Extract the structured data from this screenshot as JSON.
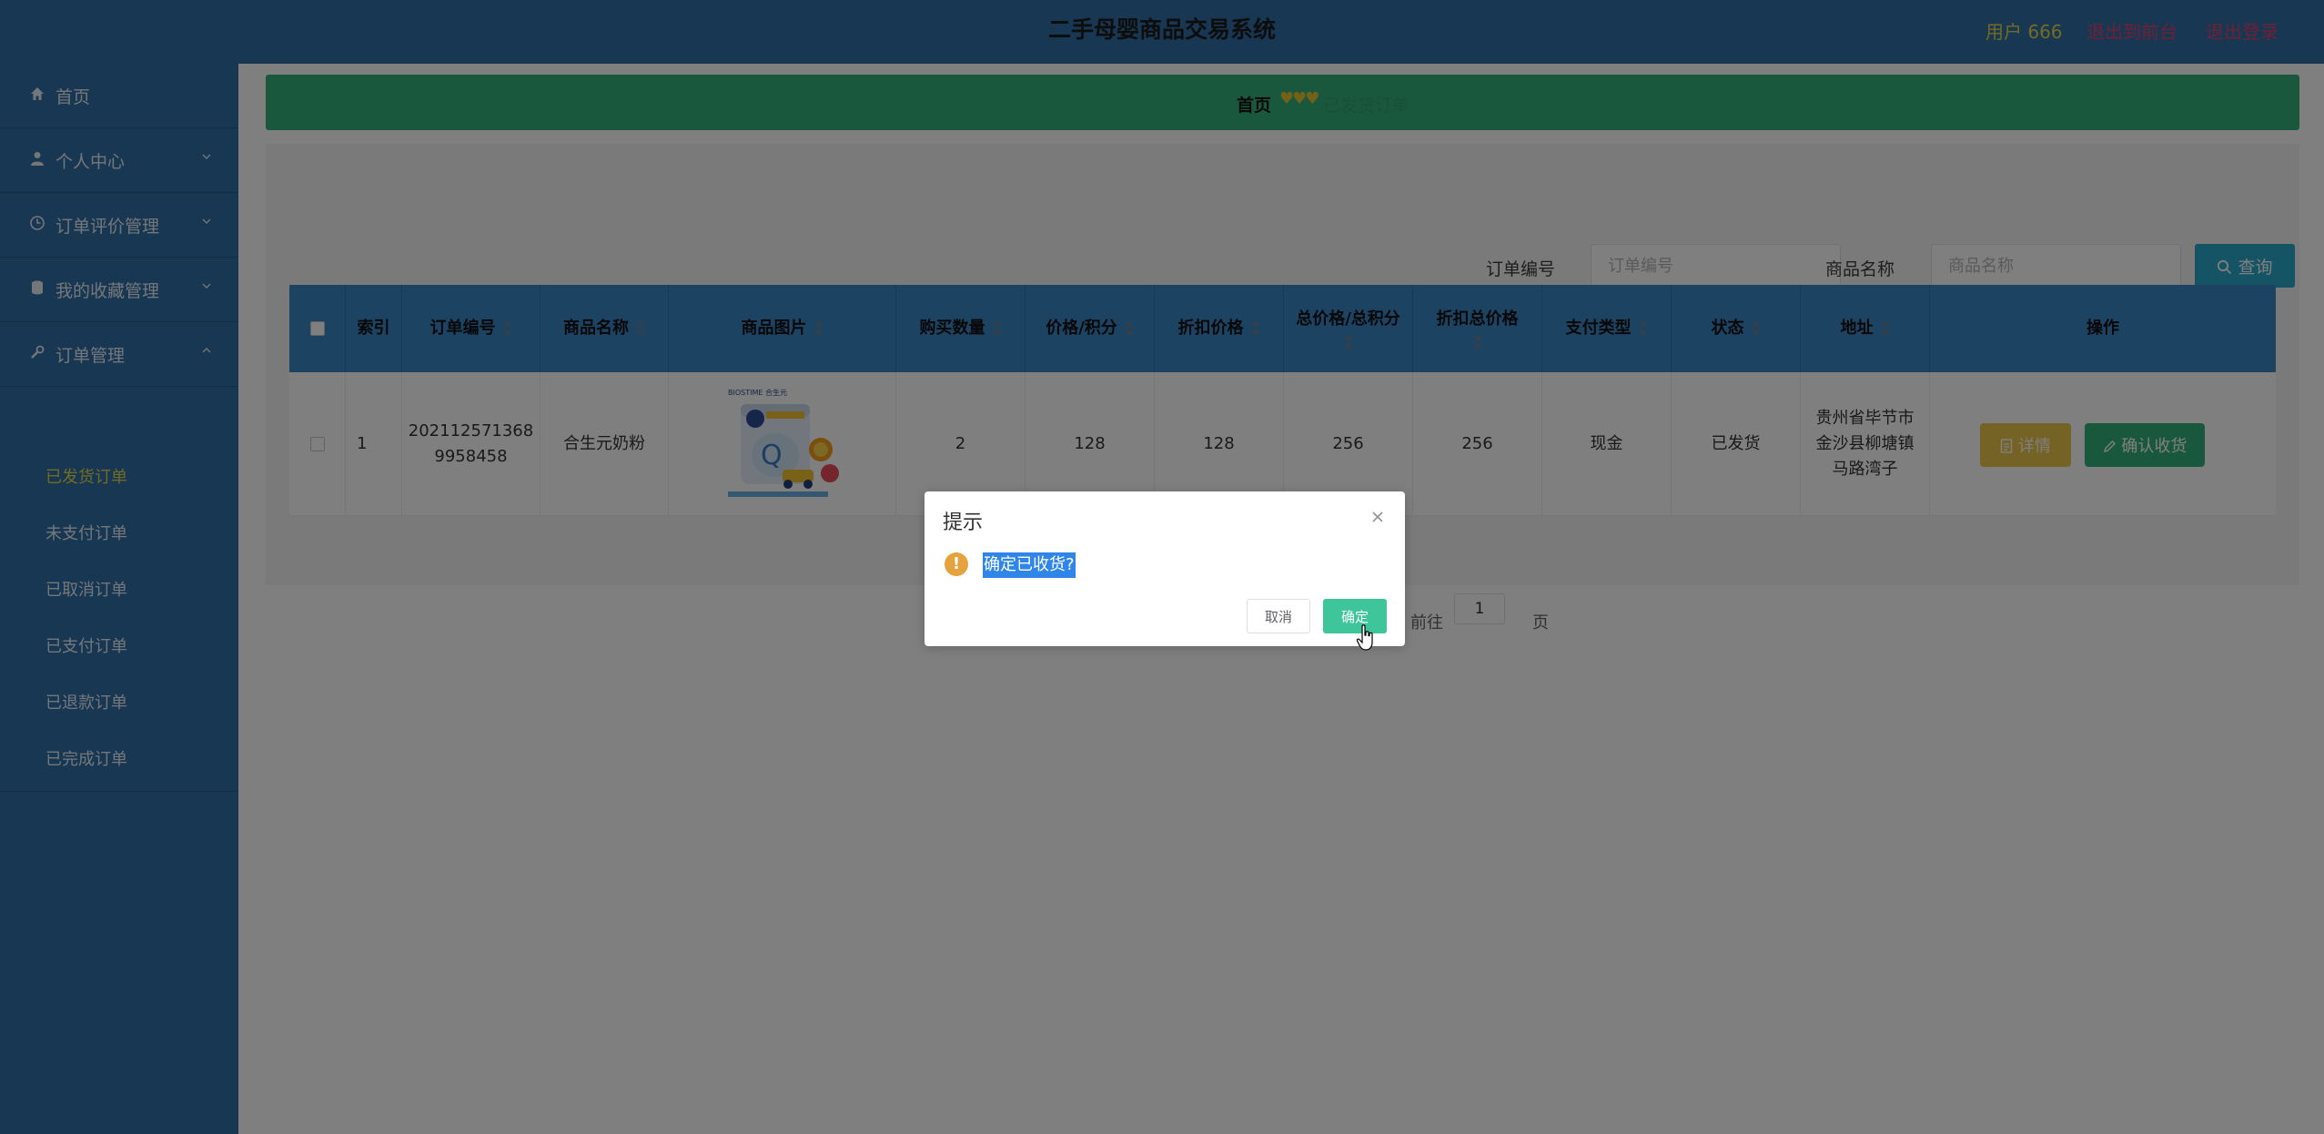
{
  "header": {
    "title": "二手母婴商品交易系统",
    "user": "用户 666",
    "back_link": "退出到前台",
    "logout_link": "退出登录"
  },
  "sidebar": {
    "items": [
      {
        "label": "首页",
        "icon": "home-icon"
      },
      {
        "label": "个人中心",
        "icon": "user-icon"
      },
      {
        "label": "订单评价管理",
        "icon": "clock-icon"
      },
      {
        "label": "我的收藏管理",
        "icon": "database-icon"
      },
      {
        "label": "订单管理",
        "icon": "wrench-icon"
      }
    ],
    "sub_items": [
      "已发货订单",
      "未支付订单",
      "已取消订单",
      "已支付订单",
      "已退款订单",
      "已完成订单"
    ],
    "active_sub": "已发货订单"
  },
  "breadcrumb": {
    "home": "首页",
    "separator": "♥♥♥",
    "current": "已发货订单"
  },
  "search": {
    "order_no_label": "订单编号",
    "order_no_placeholder": "订单编号",
    "product_label": "商品名称",
    "product_placeholder": "商品名称",
    "query_button": "查询"
  },
  "table": {
    "columns": [
      "索引",
      "订单编号",
      "商品名称",
      "商品图片",
      "购买数量",
      "价格/积分",
      "折扣价格",
      "总价格/总积分",
      "折扣总价格",
      "支付类型",
      "状态",
      "地址",
      "操作"
    ],
    "rows": [
      {
        "index": "1",
        "order_no": "202112571368 9958458",
        "product": "合生元奶粉",
        "quantity": "2",
        "price": "128",
        "discount_price": "128",
        "total": "256",
        "discount_total": "256",
        "pay_type": "现金",
        "status": "已发货",
        "address": "贵州省毕节市 金沙县柳塘镇 马路湾子",
        "detail_button": "详情",
        "confirm_button": "确认收货"
      }
    ]
  },
  "pager": {
    "goto_label": "前往",
    "page": "1",
    "page_suffix": "页"
  },
  "dialog": {
    "title": "提示",
    "message": "确定已收货?",
    "cancel": "取消",
    "ok": "确定"
  },
  "colors": {
    "header_bg": "#2f6fa6",
    "sidebar_bg": "#2e6ea5",
    "breadcrumb_bg": "#35b17c",
    "table_head_bg": "#3b86c6",
    "query_button": "#2aa8c9",
    "detail_button": "#e9c64b",
    "confirm_button": "#35b17c",
    "dialog_ok": "#3fc59a",
    "user_text": "#e6d64a",
    "link_text": "#e0406a"
  }
}
